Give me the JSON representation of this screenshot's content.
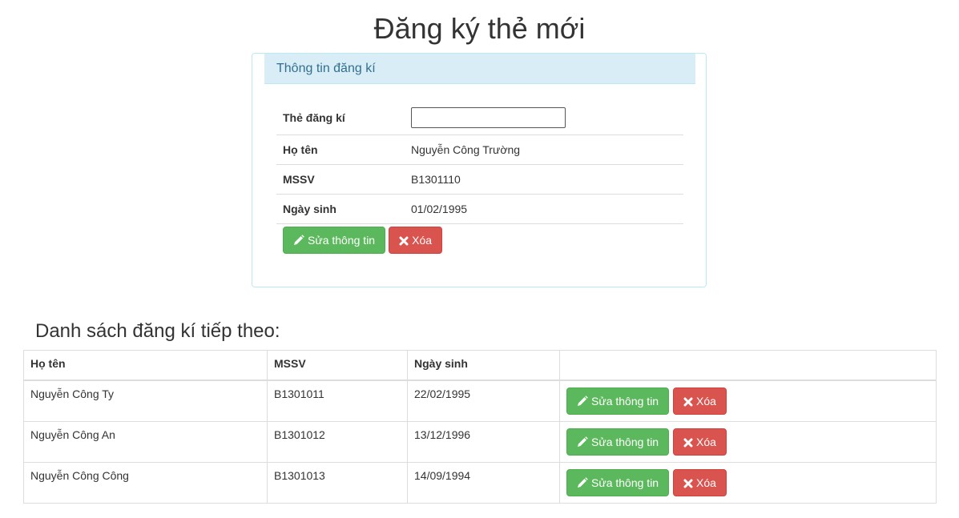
{
  "page_title": "Đăng ký thẻ mới",
  "panel": {
    "heading": "Thông tin đăng kí",
    "fields": [
      {
        "label": "Thẻ đăng kí",
        "value": ""
      },
      {
        "label": "Họ tên",
        "value": "Nguyễn Công Trường"
      },
      {
        "label": "MSSV",
        "value": "B1301110"
      },
      {
        "label": "Ngày sinh",
        "value": "01/02/1995"
      }
    ],
    "edit_label": "Sửa thông tin",
    "delete_label": "Xóa"
  },
  "list": {
    "heading": "Danh sách đăng kí tiếp theo:",
    "columns": [
      "Họ tên",
      "MSSV",
      "Ngày sinh",
      ""
    ],
    "rows": [
      {
        "name": "Nguyễn Công Ty",
        "mssv": "B1301011",
        "dob": "22/02/1995",
        "edit_label": "Sửa thông tin",
        "delete_label": "Xóa"
      },
      {
        "name": "Nguyễn Công An",
        "mssv": "B1301012",
        "dob": "13/12/1996",
        "edit_label": "Sửa thông tin",
        "delete_label": "Xóa"
      },
      {
        "name": "Nguyễn Công Công",
        "mssv": "B1301013",
        "dob": "14/09/1994",
        "edit_label": "Sửa thông tin",
        "delete_label": "Xóa"
      }
    ]
  },
  "icons": {
    "edit": "pencil-icon",
    "delete": "close-icon"
  },
  "colors": {
    "success": "#5cb85c",
    "danger": "#d9534f",
    "panel_heading_bg": "#d9edf7",
    "panel_heading_text": "#31708f"
  }
}
